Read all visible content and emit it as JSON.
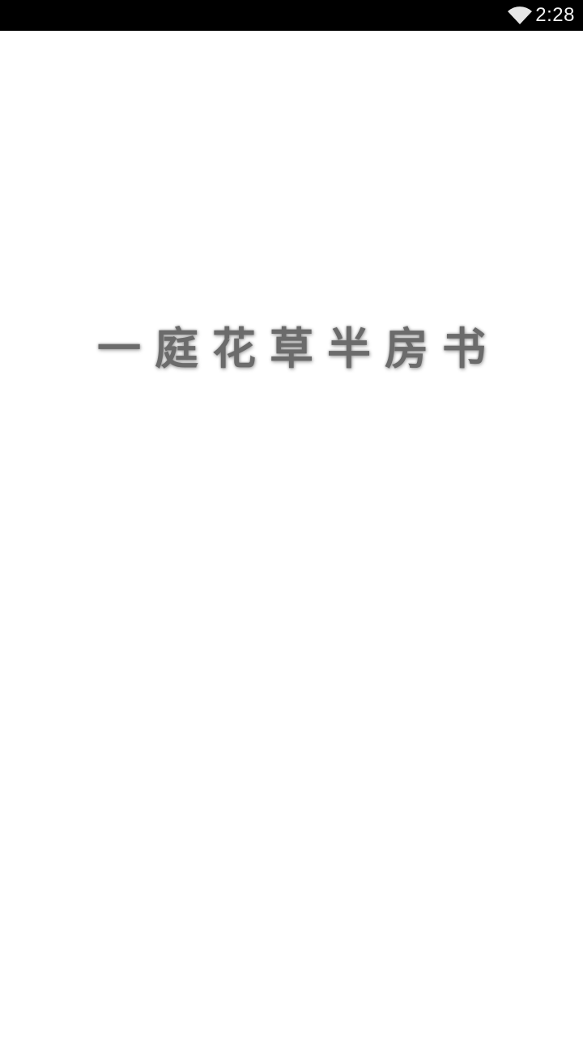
{
  "status_bar": {
    "time": "2:28",
    "wifi_icon": "wifi-icon"
  },
  "splash": {
    "slogan": "一庭花草半房书",
    "text_color": "#6b6b6b",
    "background": "#ffffff"
  }
}
